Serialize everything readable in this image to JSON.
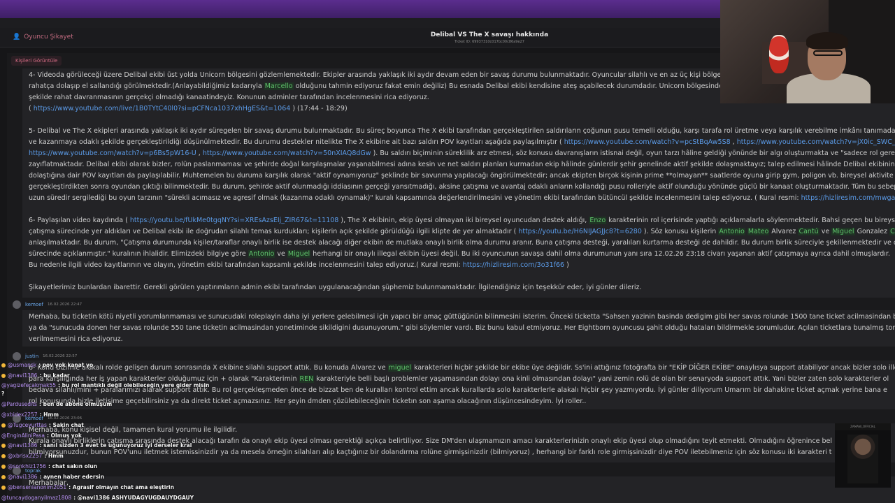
{
  "header": {
    "crumb_label": "Oyuncu Şikayet",
    "title": "Delibal VS The X savaşı hakkında",
    "ticket_id": "Ticket ID: 69937310c017bc00c86a9e27"
  },
  "chip_label": "Kişileri Görüntüle",
  "post": {
    "p4": {
      "l1": "4- Videoda görüleceği üzere Delibal ekibi üst yolda Unicorn bölgesini gözlemlemektedir. Ekipler arasında yaklaşık iki aydır devam eden bir savaş durumu bulunmaktadır. Oyuncular silahlı ve en az üç kişi bölgede",
      "l2a": "rahatça dolaşıp el sallandığı görülmektedir.(Anlayabildiğimiz kadarıyla ",
      "l2name": "Marcello",
      "l2b": " olduğunu tahmin ediyoruz fakat emin değiliz) Bu esnada Delibal ekibi kendisine ateş açabilecek durumdadır. Unicorn bölgesinde",
      "l3": "şekilde rahat davranmasının gerçekçi olmadığı kanaatindeyiz. Konunun adminler tarafından incelenmesini rica ediyoruz.",
      "l4a": "( ",
      "l4link": "https://www.youtube.com/live/1B0TYtC40l0?si=pCFNca1037xhHgES&t=1064",
      "l4b": " ) (17:44 - 18:29)"
    },
    "p5": {
      "l1": "5- Delibal ve The X ekipleri arasında yaklaşık iki aydır süregelen bir savaş durumu bulunmaktadır. Bu süreç boyunca The X ekibi tarafından gerçekleştirilen saldırıların çoğunun pusu temelli olduğu, karşı tarafa rol üretme veya karşılık verebilme imkânı tanımadan,",
      "l2a": "ve kazanmaya odaklı şekilde gerçekleştirildiği düşünülmektedir. Bu durumu destekler nitelikte The X ekibine ait bazı saldırı POV kayıtları aşağıda paylaşılmıştır ( ",
      "l2link1": "https://www.youtube.com/watch?v=pcStBqAw5S8",
      "l2sep": " , ",
      "l2link2": "https://www.youtube.com/watch?v=jX0ic_SWC_k",
      "l3link1": "https://www.youtube.com/watch?v=p6Bs5pW16-U",
      "l3sep": " , ",
      "l3link2": "https://www.youtube.com/watch?v=50nXIAQ8dGw",
      "l3b": " ). Bu saldırı biçiminin süreklilik arz etmesi, söz konusu davranışların istisnai değil, oyun tarzı hâline geldiği yönünde bir algı oluşturmakta ve \"sadece rol gereği\"",
      "l4": "zayıflatmaktadır. Delibal ekibi olarak bizler, rolün paslanmaması ve şehirde doğal karşılaşmalar yaşanabilmesi adına kesin ve net saldırı planları kurmadan ekip hâlinde günlerdir şehir genelinde aktif şekilde dolaşmaktayız; talep edilmesi hâlinde Delibal ekibinin g",
      "l5": "dolaştığına dair POV kayıtları da paylaşılabilir. Muhtemelen bu duruma karşılık olarak \"aktif oynamıyoruz\" şeklinde bir savunma yapılacağı öngörülmektedir; ancak ekipten birçok kişinin prime **olmayan** saatlerde oyuna girip gym, poligon vb. bireysel aktivite",
      "l6": "gerçekleştirdikten sonra oyundan çıktığı bilinmektedir. Bu durum, şehirde aktif olunmadığı iddiasının gerçeği yansıtmadığı, aksine çatışma ve avantaj odaklı anların kollandığı pusu rolleriyle aktif olunduğu yönünde güçlü bir kanaat oluşturmaktadır. Tüm bu sebepl",
      "l7a": "uzun süredir sergilediği bu oyun tarzının \"sürekli acımasız ve agresif olmak (kazanma odaklı oynamak)\" kuralı kapsamında değerlendirilmesini ve yönetim ekibi tarafından bütüncül şekilde incelenmesini talep ediyoruz. ( Kural resmi: ",
      "l7link": "https://hizliresim.com/mwgaw"
    },
    "p6": {
      "l1a": "6- Paylaşılan video kaydında ( ",
      "l1link": "https://youtu.be/fUkMe0tgqNY?si=XREsAzsEIj_ZIR67&t=11108",
      "l1b": " ), The X ekibinin, ekip üyesi olmayan iki bireysel oyuncudan destek aldığı, ",
      "l1name": "Enzo",
      "l1c": " karakterinin rol içerisinde yaptığı açıklamalarla söylenmektedir. Bahsi geçen bu bireysel o",
      "l2a": "çatışma sürecinde yer aldıkları ve Delibal ekibi ile doğrudan silahlı temas kurdukları; kişilerin açık şekilde görüldüğü ilgili klipte de yer almaktadır ( ",
      "l2link": "https://youtu.be/H6NIJAGJJc8?t=6280",
      "l2b": " ). Söz konusu kişilerin ",
      "l2n1": "Antonio",
      "l2n2": "Mateo",
      "l2c": " Alvarez ",
      "l2n3": "Cantú",
      "l2d": " ve ",
      "l2n4": "Miguel",
      "l2e": " Gonzalez ",
      "l2n5": "C",
      "l3": "anlaşılmaktadır. Bu durum, \"Çatışma durumunda kişiler/taraflar onaylı birlik ise destek alacağı diğer ekibin de mutlaka onaylı birlik olma durumu aranır. Buna çatışma desteği, yaralıları kurtarma desteği de dahildir. Bu durum birlik süreciyle şekillenmektedir ve de",
      "l4a": "sürecinde açıklanmıştır.\" kuralının ihlalidir. Elimizdeki bilgiye göre ",
      "l4n1": "Antonio",
      "l4b": " ve ",
      "l4n2": "Miguel",
      "l4c": " herhangi bir onaylı illegal ekibin üyesi değil. Bu iki oyuncunun savaşa dahil olma durumunun yanı sıra 12.02.26 23:18 civarı yaşanan aktif çatışmaya ayrıca dahil olmuşlardır.",
      "l5a": "Bu nedenle ilgili video kayıtlarının ve olayın, yönetim ekibi tarafından kapsamlı şekilde incelenmesini talep ediyoruz.( Kural resmi: ",
      "l5link": "https://hizliresim.com/3o31f66",
      "l5b": " )"
    },
    "closing": "Şikayetlerimiz bunlardan ibarettir. Gerekli görülen yaptırımların admin ekibi tarafından uygulanacağından şüphemiz bulunmamaktadır. İlgilendiğiniz için teşekkür eder, iyi günler dileriz."
  },
  "reply1": {
    "author": "kemoef",
    "date": "16.02.2026 22:47",
    "l1": "Merhaba, bu ticketin kötü niyetli yorumlanmaması ve sunucudaki roleplayin daha iyi yerlere gelebilmesi için yapıcı bir amaç güttüğünün bilinmesini isterim. Önceki ticketta \"Sahsen yazinin basinda dedigim gibi her savas rolunde 1500 tane ticket acilmasindan bikr",
    "l2": "ya da \"sunucuda donen her savas rolunde 550 tane ticketin acilmasindan yonetiminde sikildigini dusunuyorum.\" gibi söylemler vardı. Biz bunu kabul etmiyoruz. Her Eightborn oyuncusu şahit olduğu hataları bildirmekle sorumludur. Açılan ticketlara bunalmış tonla",
    "l3": "verilmemesini rica ediyoruz."
  },
  "reply2": {
    "author": "justin",
    "date": "16.02.2026 22:57",
    "l1a": "6- Konu bizimle alakalı rolde gelişen durum sonrasında X ekibine silahlı support attık. Bu konuda Alvarez ve ",
    "l1name": "miguel",
    "l1b": " karakterleri hiçbir şekilde bir ekibe üye değildir. Ss'ini attığınız fotoğrafta bir \"EKİP DİĞER EKİBE\" onaylısya support atabiliyor ancak bizler solo illeg",
    "l2a": "para karşılığında her iş yapan karakterler olduğumuz için + olarak \"Karakterimin ",
    "l2name": "REN",
    "l2b": " karakteriyle belli başlı problemler yaşamasından dolayı ona kinli olmasından dolayı\" yani zemin rolü de olan bir senaryoda support attık. Yani bizler zaten solo karakterler ol",
    "l3": "bedava silahlı/mini + paralarımızı alarak support attık. Bu rol gerçekleşmeden önce de bizzat ben de kuralları kontrol ettim ancak kurallarda solo karakterlerle alakalı hiçbir şey yazmıyordu. İyi günler diliyorum Umarım bir dahakine ticket açmak yerine bana e",
    "l4": "rol konusunda bizle iletişime geçebilirsiniz ya da direkt ticket açmazsınız. Her şeyin dmden çözülebileceğinin ticketın son aşama olacağının düşüncesindeyim. İyi roller.."
  },
  "reply3": {
    "author": "kemoef",
    "date": "16.02.2026 23:06",
    "l1": "Merhaba, konu kişisel değil, tamamen kural yorumu ile ilgilidir.",
    "l2": "Kurala onaylı birliklerin çatışma sırasında destek alacağı tarafın da onaylı ekip üyesi olması gerektiği açıkça belirtiliyor. Size DM'den ulaşmamızın amacı karakterlerinizin onaylı ekip üyesi olup olmadığını teyit etmekti. Olmadığını öğrenince bel",
    "l3": "bilmiyorsunuzdur, bunun POV'unu iletmek istemissinizdir ya da mesela örneğin silahları alıp kaçtığınız bir dolandırma rolüne girmişsinizdir (bilmiyoruz) , herhangi bir farklı role girmişsinizdir diye POV iletebilmeniz için söz konusu iki karakteri t"
  },
  "reply4": {
    "author": "toprak",
    "l1": "Merhabalar,"
  },
  "chat": [
    {
      "user": "@usmansk",
      "text": ": pov yok kanat yo"
    },
    {
      "user": "@navi1386",
      "text": ": bu kadar"
    },
    {
      "user": "@yagizefecakmak55",
      "text": ": bu rol mantıklı değil olebileceğin yere gider misin"
    },
    {
      "user": "",
      "text": "?"
    },
    {
      "user": "@Pardusedits",
      "text": ": ben de abone olmuşum"
    },
    {
      "user": "@xbidex2257",
      "text": ": Hmm"
    },
    {
      "user": "@Tugceyurttas",
      "text": ": Sakin chat"
    },
    {
      "user": "@EnginAliniPasa",
      "text": ": Olmuş yok"
    },
    {
      "user": "@navi1386",
      "text": ": sanıl sizden 3 evet te uğunuyoruz iyi derseler kral"
    },
    {
      "user": "@xbrisx2257",
      "text": ": Hmm"
    },
    {
      "user": "@sonkhlz1756",
      "text": ": chat sakın olun"
    },
    {
      "user": "@navi1386",
      "text": ": aynen haber edersin"
    },
    {
      "user": "@bensenianonim2051",
      "text": ": Agrasif olmayın chat ama eleştirin"
    },
    {
      "user": "@tuncaydoganyilmaz1808",
      "text": ": @navi1386 ASHYUDAGYUGDAUYDGAUY"
    }
  ],
  "cam2_banner": "ZAMANI_OFFICIAL",
  "colors": {
    "accent": "#5b2d8e",
    "link": "#5b9be8",
    "mention": "#5fc26b",
    "author": "#6aa7ea"
  }
}
